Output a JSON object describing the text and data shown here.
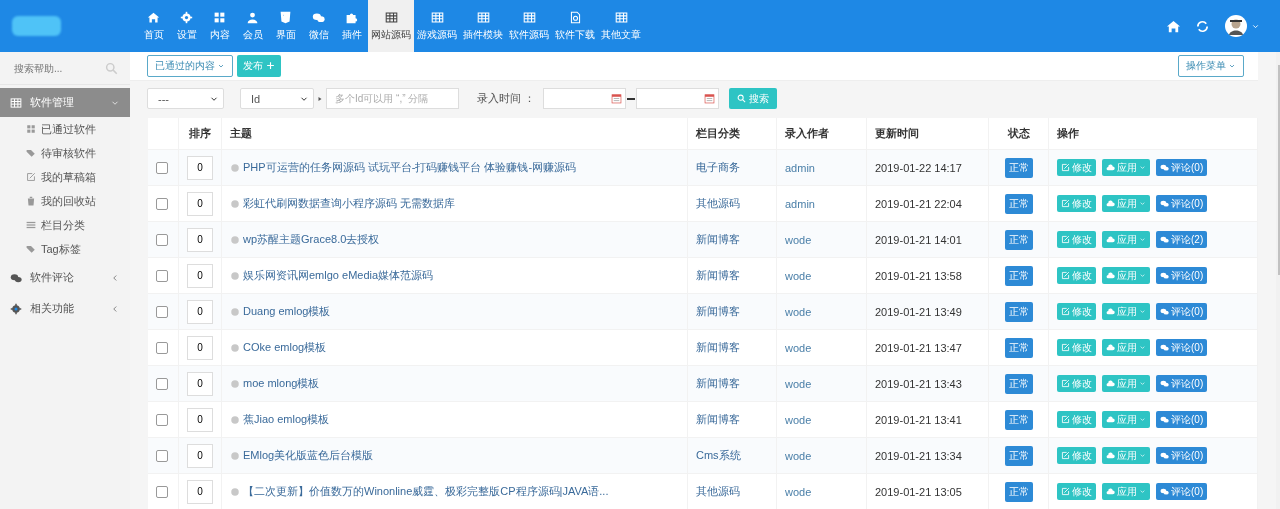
{
  "nav": [
    {
      "label": "首页",
      "selected": false
    },
    {
      "label": "设置",
      "selected": false
    },
    {
      "label": "内容",
      "selected": false
    },
    {
      "label": "会员",
      "selected": false
    },
    {
      "label": "界面",
      "selected": false
    },
    {
      "label": "微信",
      "selected": false
    },
    {
      "label": "插件",
      "selected": false
    },
    {
      "label": "网站源码",
      "selected": true
    },
    {
      "label": "游戏源码",
      "selected": false
    },
    {
      "label": "插件模块",
      "selected": false
    },
    {
      "label": "软件源码",
      "selected": false
    },
    {
      "label": "软件下载",
      "selected": false
    },
    {
      "label": "其他文章",
      "selected": false
    }
  ],
  "sidebar": {
    "search": {
      "placeholder": "搜索帮助..."
    },
    "groups": [
      {
        "label": "软件管理",
        "selected": true,
        "expanded": true,
        "children": [
          {
            "label": "已通过软件"
          },
          {
            "label": "待审核软件"
          },
          {
            "label": "我的草稿箱"
          },
          {
            "label": "我的回收站"
          },
          {
            "label": "栏目分类"
          },
          {
            "label": "Tag标签"
          }
        ]
      },
      {
        "label": "软件评论",
        "selected": false,
        "expanded": false
      },
      {
        "label": "相关功能",
        "selected": false,
        "expanded": false
      }
    ]
  },
  "toolbar": {
    "filter_button": "已通过的内容",
    "publish_button": "发布",
    "menu_button": "操作菜单"
  },
  "filters": {
    "select_1": "---",
    "select_2": "Id",
    "id_field": {
      "placeholder": "多个Id可以用 “,” 分隔"
    },
    "time_label": "录入时间 ：",
    "search_button": "搜索"
  },
  "table": {
    "columns": [
      "排序",
      "主题",
      "栏目分类",
      "录入作者",
      "更新时间",
      "状态",
      "操作"
    ],
    "rows": [
      {
        "checked": false,
        "order": "0",
        "title": "PHP可运营的任务网源码 试玩平台-打码赚钱平台 体验赚钱-网赚源码",
        "category": "电子商务",
        "author": "admin",
        "time": "2019-01-22 14:17",
        "status": "正常",
        "actions": [
          "修改",
          "应用",
          "评论(0)"
        ]
      },
      {
        "checked": false,
        "order": "0",
        "title": "彩虹代刷网数据查询小程序源码 无需数据库",
        "category": "其他源码",
        "author": "admin",
        "time": "2019-01-21 22:04",
        "status": "正常",
        "actions": [
          "修改",
          "应用",
          "评论(0)"
        ]
      },
      {
        "checked": false,
        "order": "0",
        "title": "wp苏醒主题Grace8.0去授权",
        "category": "新闻博客",
        "author": "wode",
        "time": "2019-01-21 14:01",
        "status": "正常",
        "actions": [
          "修改",
          "应用",
          "评论(2)"
        ]
      },
      {
        "checked": false,
        "order": "0",
        "title": "娱乐网资讯网emlgo eMedia媒体范源码",
        "category": "新闻博客",
        "author": "wode",
        "time": "2019-01-21 13:58",
        "status": "正常",
        "actions": [
          "修改",
          "应用",
          "评论(0)"
        ]
      },
      {
        "checked": false,
        "order": "0",
        "title": "Duang emlog模板",
        "category": "新闻博客",
        "author": "wode",
        "time": "2019-01-21 13:49",
        "status": "正常",
        "actions": [
          "修改",
          "应用",
          "评论(0)"
        ]
      },
      {
        "checked": false,
        "order": "0",
        "title": "COke emlog模板",
        "category": "新闻博客",
        "author": "wode",
        "time": "2019-01-21 13:47",
        "status": "正常",
        "actions": [
          "修改",
          "应用",
          "评论(0)"
        ]
      },
      {
        "checked": false,
        "order": "0",
        "title": "moe mlong模板",
        "category": "新闻博客",
        "author": "wode",
        "time": "2019-01-21 13:43",
        "status": "正常",
        "actions": [
          "修改",
          "应用",
          "评论(0)"
        ]
      },
      {
        "checked": false,
        "order": "0",
        "title": "蕉Jiao emlog模板",
        "category": "新闻博客",
        "author": "wode",
        "time": "2019-01-21 13:41",
        "status": "正常",
        "actions": [
          "修改",
          "应用",
          "评论(0)"
        ]
      },
      {
        "checked": false,
        "order": "0",
        "title": "EMlog美化版蓝色后台模版",
        "category": "Cms系统",
        "author": "wode",
        "time": "2019-01-21 13:34",
        "status": "正常",
        "actions": [
          "修改",
          "应用",
          "评论(0)"
        ]
      },
      {
        "checked": false,
        "order": "0",
        "title": "【二次更新】价值数万的Winonline威霆、极彩完整版CP程序源码|JAVA语...",
        "category": "其他源码",
        "author": "wode",
        "time": "2019-01-21 13:05",
        "status": "正常",
        "actions": [
          "修改",
          "应用",
          "评论(0)"
        ]
      }
    ]
  }
}
